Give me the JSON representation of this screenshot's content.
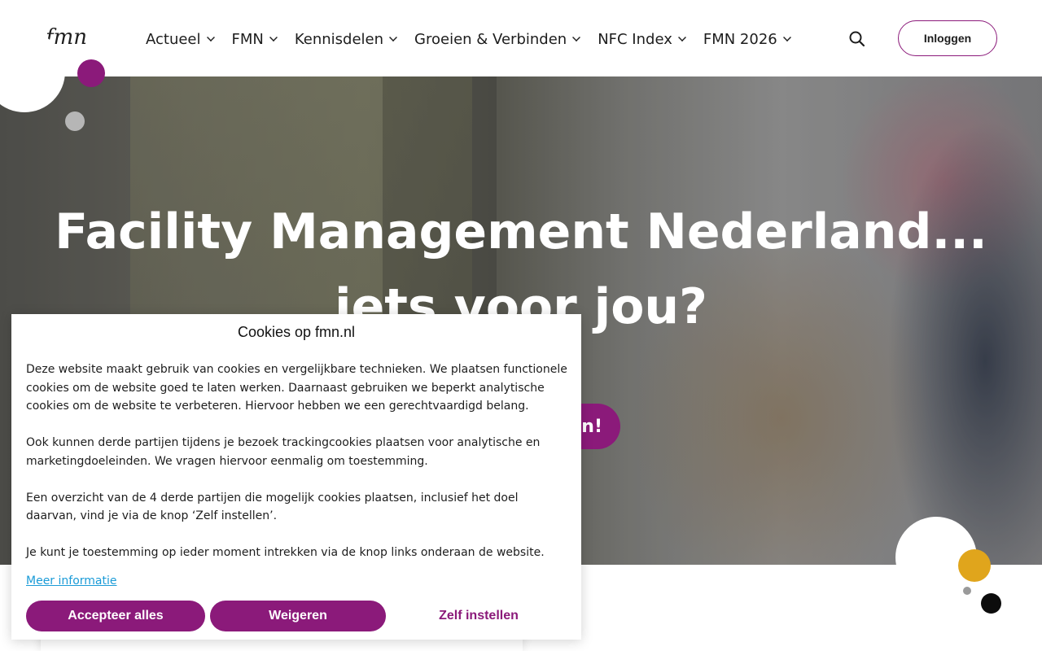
{
  "header": {
    "logo": "fmn",
    "nav": [
      {
        "label": "Actueel"
      },
      {
        "label": "FMN"
      },
      {
        "label": "Kennisdelen"
      },
      {
        "label": "Groeien & Verbinden"
      },
      {
        "label": "NFC Index"
      },
      {
        "label": "FMN 2026"
      }
    ],
    "search_icon": "search-icon",
    "login_label": "Inloggen"
  },
  "hero": {
    "title": "Facility Management Nederland... iets voor jou?",
    "cta_label": "en!"
  },
  "cookie": {
    "title": "Cookies op fmn.nl",
    "paragraphs": [
      "Deze website maakt gebruik van cookies en vergelijkbare technieken. We plaatsen functionele cookies om de website goed te laten werken. Daarnaast gebruiken we beperkt analytische cookies om de website te verbeteren. Hiervoor hebben we een gerechtvaardigd belang.",
      "Ook kunnen derde partijen tijdens je bezoek trackingcookies plaatsen voor analytische en marketingdoeleinden. We vragen hiervoor eenmalig om toestemming.",
      "Een overzicht van de 4 derde partijen die mogelijk cookies plaatsen, inclusief het doel daarvan, vind je via de knop ‘Zelf instellen’.",
      "Je kunt je toestemming op ieder moment intrekken via de knop links onderaan de website."
    ],
    "more_link": "Meer informatie",
    "accept_label": "Accepteer alles",
    "decline_label": "Weigeren",
    "self_label": "Zelf instellen"
  },
  "colors": {
    "brand_purple": "#8b1a7a",
    "accent_yellow": "#e0a51c",
    "link_blue": "#1a9bd7"
  }
}
